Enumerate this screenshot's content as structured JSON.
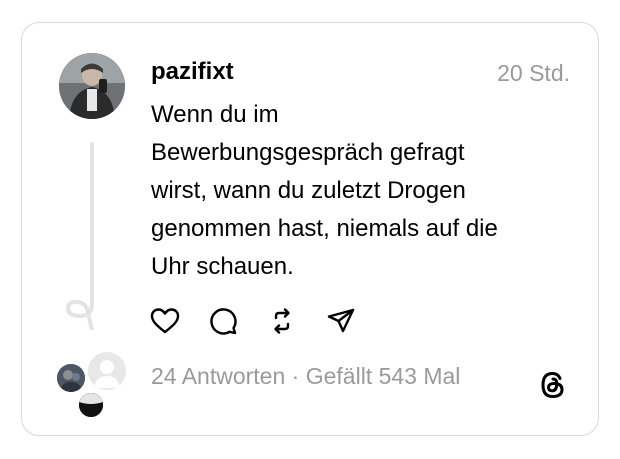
{
  "post": {
    "username": "pazifixt",
    "time": "20 Std.",
    "text_lines": [
      "Wenn du im",
      "Bewerbungsgespräch gefragt",
      "wirst, wann du zuletzt Drogen",
      "genommen hast, niemals auf die",
      "Uhr schauen."
    ]
  },
  "stats": {
    "replies": "24 Antworten",
    "separator": " · ",
    "likes": "Gefällt 543 Mal"
  },
  "icons": {
    "like": "heart-icon",
    "reply": "comment-bubble-icon",
    "repost": "repost-icon",
    "share": "send-icon",
    "brand": "threads-logo-icon"
  },
  "colors": {
    "text": "#000000",
    "muted": "#9a9a9a",
    "border": "#d9d9d9",
    "thread_line": "#e3e3e3"
  }
}
